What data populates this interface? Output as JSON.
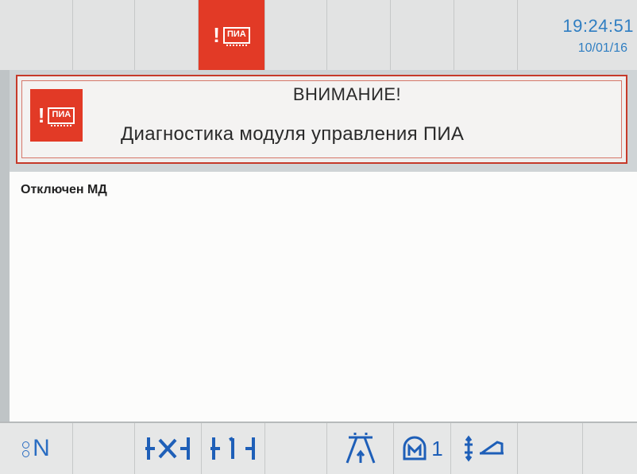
{
  "header": {
    "time": "19:24:51",
    "date": "10/01/16",
    "alarm_indicator_icon": "pia-alarm-icon",
    "alarm_icon_label": "ПИА"
  },
  "dialog": {
    "title": "ВНИМАНИЕ!",
    "message": "Диагностика модуля управления ПИА",
    "icon": "pia-alarm-icon",
    "icon_label": "ПИА",
    "body_text": "Отключен МД"
  },
  "softkeys": [
    {
      "id": "neutral",
      "label": "N",
      "icon": "neutral-position-icon"
    },
    {
      "id": "empty-1",
      "label": "",
      "icon": ""
    },
    {
      "id": "thread-trim",
      "label": "",
      "icon": "thread-trimmer-icon"
    },
    {
      "id": "stitch",
      "label": "",
      "icon": "stitch-icon"
    },
    {
      "id": "empty-2",
      "label": "",
      "icon": ""
    },
    {
      "id": "foot-lift",
      "label": "",
      "icon": "presser-foot-icon"
    },
    {
      "id": "motor",
      "label": "1",
      "icon": "motor-icon"
    },
    {
      "id": "tension",
      "label": "",
      "icon": "thread-tension-icon"
    }
  ],
  "colors": {
    "alarm_red": "#e23a26",
    "accent_blue": "#2f7ec2",
    "frame_red": "#c63a2a"
  }
}
